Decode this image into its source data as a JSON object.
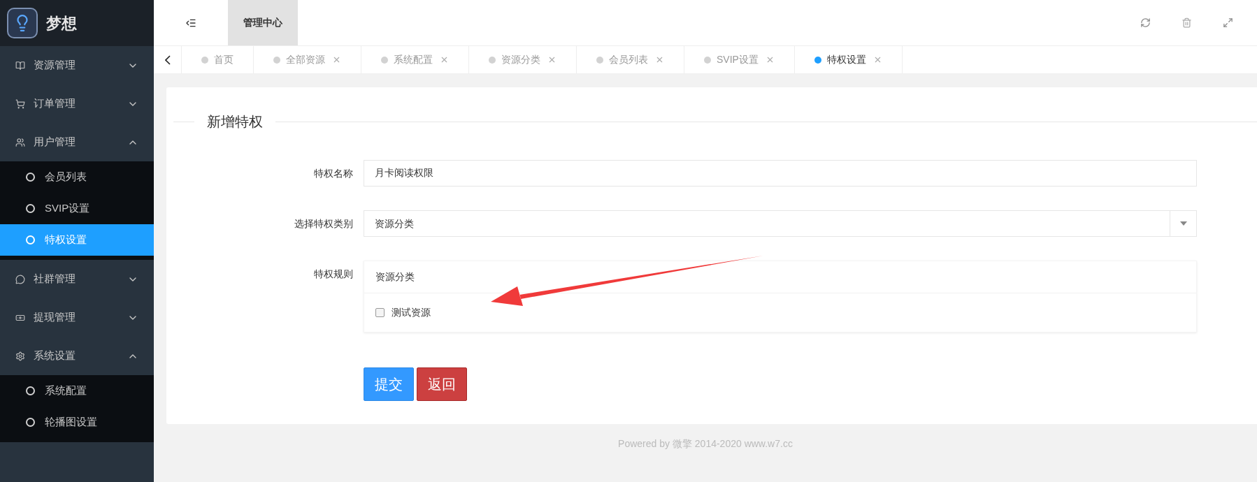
{
  "brand": {
    "name": "梦想"
  },
  "sidebar": {
    "items": [
      {
        "label": "资源管理",
        "expanded": false
      },
      {
        "label": "订单管理",
        "expanded": false
      },
      {
        "label": "用户管理",
        "expanded": true,
        "children": [
          {
            "label": "会员列表",
            "selected": false
          },
          {
            "label": "SVIP设置",
            "selected": false
          },
          {
            "label": "特权设置",
            "selected": true
          }
        ]
      },
      {
        "label": "社群管理",
        "expanded": false
      },
      {
        "label": "提现管理",
        "expanded": false
      },
      {
        "label": "系统设置",
        "expanded": true,
        "children": [
          {
            "label": "系统配置",
            "selected": false
          },
          {
            "label": "轮播图设置",
            "selected": false
          }
        ]
      }
    ]
  },
  "topbar": {
    "title": "管理中心"
  },
  "tabs": [
    {
      "label": "首页",
      "selected": false,
      "closable": false
    },
    {
      "label": "全部资源",
      "selected": false,
      "closable": true
    },
    {
      "label": "系统配置",
      "selected": false,
      "closable": true
    },
    {
      "label": "资源分类",
      "selected": false,
      "closable": true
    },
    {
      "label": "会员列表",
      "selected": false,
      "closable": true
    },
    {
      "label": "SVIP设置",
      "selected": false,
      "closable": true
    },
    {
      "label": "特权设置",
      "selected": true,
      "closable": true
    }
  ],
  "form": {
    "legend": "新增特权",
    "name_field": {
      "label": "特权名称",
      "value": "月卡阅读权限"
    },
    "category_select": {
      "label": "选择特权类别",
      "value": "资源分类"
    },
    "rules": {
      "label": "特权规则",
      "header": "资源分类",
      "options": [
        {
          "label": "测试资源",
          "checked": false
        }
      ]
    },
    "buttons": [
      {
        "label": "提交",
        "kind": "primary"
      },
      {
        "label": "返回",
        "kind": "danger"
      }
    ]
  },
  "footer": "Powered by 微擎 2014-2020 www.w7.cc"
}
